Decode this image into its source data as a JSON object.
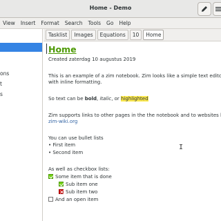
{
  "window": {
    "title": "Home - Demo"
  },
  "toolbar": {
    "edit_icon": "pencil-icon",
    "menu_icon": "hamburger-menu-icon"
  },
  "menubar": {
    "items": [
      "View",
      "Insert",
      "Format",
      "Search",
      "Tools",
      "Go",
      "Help"
    ]
  },
  "sidebar": {
    "items": [
      "ons",
      "t",
      "s"
    ]
  },
  "pathbar": {
    "crumbs": [
      "Tasklist",
      "Images",
      "Equations",
      "10",
      "Home"
    ],
    "active": "Home"
  },
  "page": {
    "heading": "Home",
    "created": "Created zaterdag 10 augustus 2019",
    "intro_line1": "This is an example of a zim notebook. Zim looks like a simple text editor",
    "intro_line2": "with inline formatting.",
    "fmt_prefix": "So text can be ",
    "fmt_bold": "bold",
    "fmt_sep1": ", ",
    "fmt_italic": "italic",
    "fmt_sep2": ", or ",
    "fmt_highlight": "highlighted",
    "links_line1": "Zim supports links to other pages in the the notebook and to websites lik",
    "links_url": "zim-wiki.org",
    "bullets_intro": "You can use bullet lists",
    "bullets": [
      "• First item",
      "• Second item"
    ],
    "checkbox_intro": "As well as checkbox lists:",
    "checkboxes": [
      {
        "label": "Some item that is done",
        "state": "done"
      },
      {
        "label": "Sub item one",
        "state": "done"
      },
      {
        "label": "Sub item two",
        "state": "cancelled"
      },
      {
        "label": "And an open item",
        "state": "open"
      }
    ]
  }
}
